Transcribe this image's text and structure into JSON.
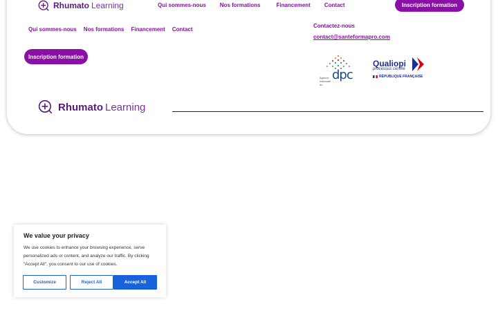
{
  "brand": {
    "name_strong": "Rhumato",
    "name_light": "Learning"
  },
  "nav": {
    "items": [
      {
        "label": "Qui sommes-nous"
      },
      {
        "label": "Nos formations"
      },
      {
        "label": "Financement"
      },
      {
        "label": "Contact"
      }
    ],
    "cta_label": "Inscription formation"
  },
  "contact": {
    "title": "Contactez-nous",
    "email": "contact@santeformapro.com"
  },
  "certifications": {
    "dpc": {
      "small_text": "Agence nationale du",
      "big_text": "dpc"
    },
    "qualiopi": {
      "name": "Qualiopi",
      "subtitle": "processus certifié",
      "footer": "RÉPUBLIQUE FRANÇAISE"
    }
  },
  "cookie": {
    "title": "We value your privacy",
    "text": "We use cookies to enhance your browsing experience, serve personalized ads or content, and analyze our traffic. By clicking \"Accept All\", you consent to our use of cookies.",
    "customize_label": "Customize",
    "reject_label": "Reject All",
    "accept_label": "Accept All"
  },
  "colors": {
    "brand_purple": "#8a0fa6",
    "cookie_blue": "#1863dc"
  },
  "icons": {
    "logo": "plus-circle-icon"
  }
}
